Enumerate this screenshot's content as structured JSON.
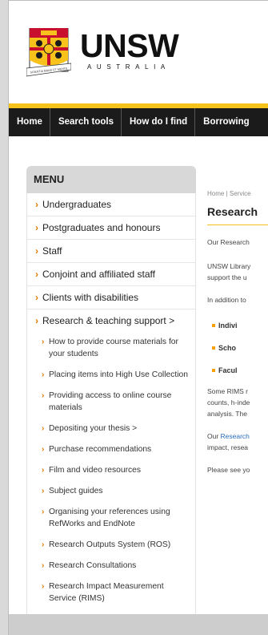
{
  "brand": {
    "name": "UNSW",
    "subtitle": "AUSTRALIA",
    "motto": "SCIENTIA MANU ET MENTE"
  },
  "nav": [
    "Home",
    "Search tools",
    "How do I find",
    "Borrowing"
  ],
  "sidebar": {
    "heading": "MENU",
    "items": [
      "Undergraduates",
      "Postgraduates and honours",
      "Staff",
      "Conjoint and affiliated staff",
      "Clients with disabilities",
      "Research & teaching support >"
    ],
    "subitems": [
      "How to provide course materials for your students",
      "Placing items into High Use Collection",
      "Providing access to online course materials",
      "Depositing your thesis >",
      "Purchase recommendations",
      "Film and video resources",
      "Subject guides",
      "Organising your references using RefWorks and EndNote",
      "Research Outputs System (ROS)",
      "Research Consultations",
      "Research Impact Measurement Service (RIMS)"
    ]
  },
  "content": {
    "breadcrumb": "Home | Service",
    "title": "Research",
    "p1": "Our Research",
    "p2a": "UNSW Library",
    "p2b": "support the u",
    "p3": "In addition to",
    "bullets": [
      "Indivi",
      "Scho",
      "Facul"
    ],
    "p4a": "Some RIMS r",
    "p4b": "counts, h-inde",
    "p4c": "analysis. The",
    "p5_link": "Research",
    "p5a_pre": "Our ",
    "p5b": "impact, resea",
    "p6": "Please see yo"
  },
  "colors": {
    "accent": "#f6c21b",
    "arrow": "#e07a00",
    "nav_bg": "#1b1b1b",
    "link": "#2a6ebb"
  }
}
